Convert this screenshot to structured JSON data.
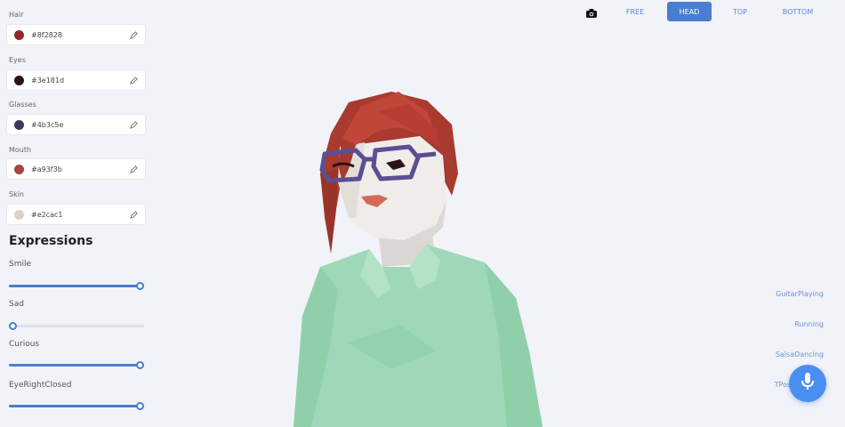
{
  "colors": {
    "items": [
      {
        "label": "Hair",
        "value": "#8f2828",
        "swatch": "#8f2828"
      },
      {
        "label": "Eyes",
        "value": "#3e181d",
        "swatch": "#2b1418"
      },
      {
        "label": "Glasses",
        "value": "#4b3c5e",
        "swatch": "#3f3a5c"
      },
      {
        "label": "Mouth",
        "value": "#a93f3b",
        "swatch": "#a8433f"
      },
      {
        "label": "Skin",
        "value": "#e2cac1",
        "swatch": "#dccfc8"
      }
    ],
    "edit_icon": "pencil-icon"
  },
  "expressions": {
    "heading": "Expressions",
    "sliders": [
      {
        "label": "Smile",
        "level": 1.0
      },
      {
        "label": "Sad",
        "level": 0.0
      },
      {
        "label": "Curious",
        "level": 1.0
      },
      {
        "label": "EyeRightClosed",
        "level": 1.0
      }
    ]
  },
  "nav": {
    "camera_icon": "camera-icon",
    "tabs": [
      {
        "label": "FREE",
        "active": false
      },
      {
        "label": "HEAD",
        "active": true
      },
      {
        "label": "TOP",
        "active": false
      },
      {
        "label": "BOTTOM",
        "active": false
      }
    ]
  },
  "animations": {
    "items": [
      "GuitarPlaying",
      "Running",
      "SalsaDancing",
      "TPose"
    ]
  },
  "mic": {
    "icon": "microphone-icon"
  },
  "theme": {
    "accent": "#4a7dcf",
    "background": "#f1f3f8",
    "mic_color": "#4a8ef0"
  }
}
